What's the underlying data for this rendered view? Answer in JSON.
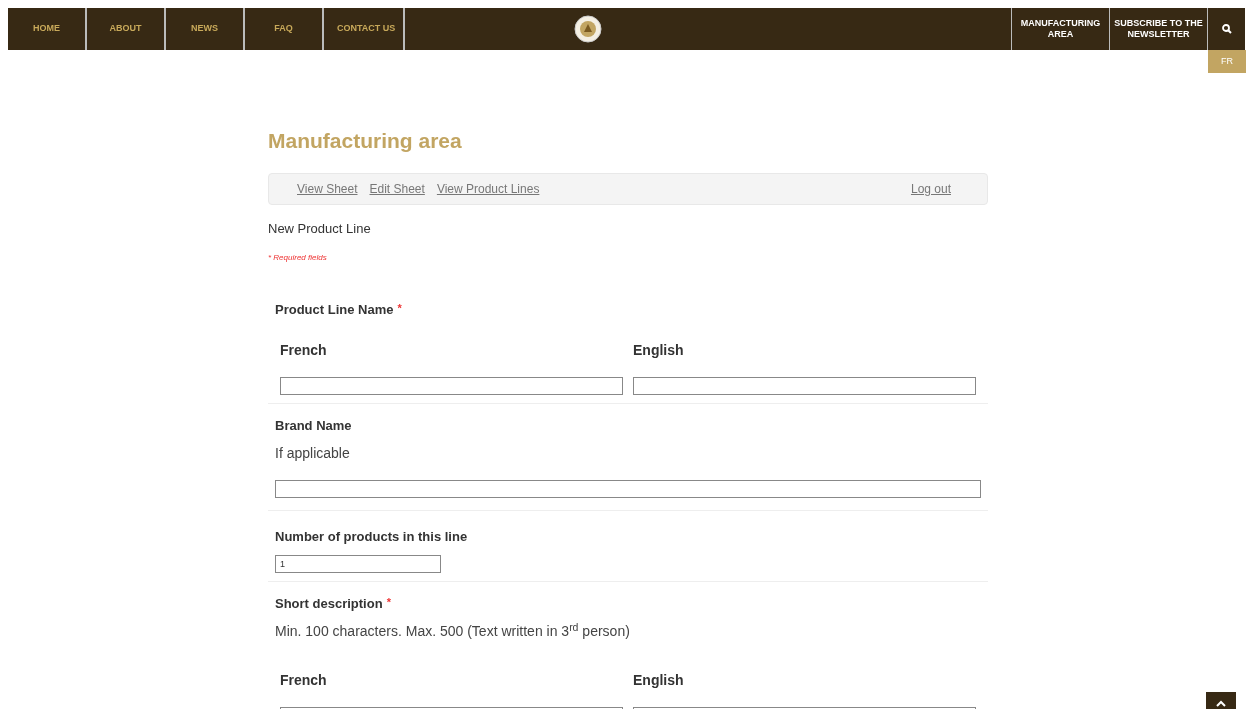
{
  "nav": {
    "left": [
      {
        "label": "HOME"
      },
      {
        "label": "ABOUT"
      },
      {
        "label": "NEWS"
      },
      {
        "label": "FAQ"
      },
      {
        "label": "CONTACT US"
      }
    ],
    "right": [
      {
        "label": "MANUFACTURING AREA"
      },
      {
        "label": "SUBSCRIBE TO THE NEWSLETTER"
      }
    ],
    "language": "FR"
  },
  "title": "Manufacturing area",
  "subnav": {
    "links": [
      {
        "label": "View Sheet"
      },
      {
        "label": "Edit Sheet"
      },
      {
        "label": "View Product Lines"
      }
    ],
    "logout": "Log out"
  },
  "form_title": "New Product Line",
  "required_note": "* Required fields",
  "required_mark": "*",
  "fields": [
    {
      "kind": "bilingual",
      "label": "Product Line Name",
      "required": true,
      "columns": [
        {
          "label": "French"
        },
        {
          "label": "English"
        }
      ]
    },
    {
      "kind": "text",
      "label": "Brand Name",
      "required": false,
      "help": "If applicable"
    },
    {
      "kind": "number",
      "label": "Number of products in this line",
      "required": false,
      "value": "1"
    },
    {
      "kind": "bilingual_area",
      "label": "Short description",
      "required": true,
      "help": "Min. 100 characters. Max. 500 (Text written in 3$^{rd}$ person)",
      "columns": [
        {
          "label": "French"
        },
        {
          "label": "English"
        }
      ]
    }
  ]
}
